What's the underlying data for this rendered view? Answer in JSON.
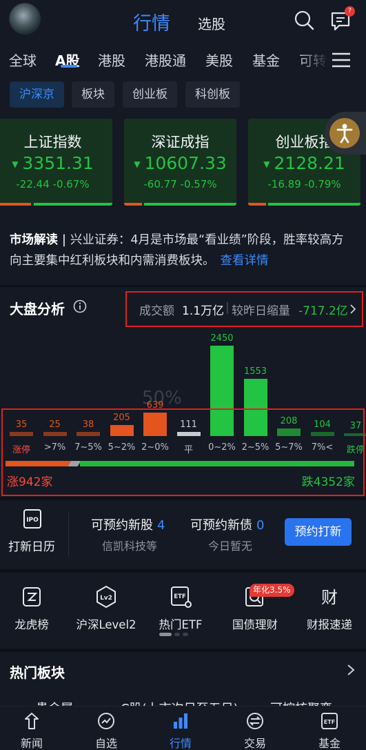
{
  "header": {
    "title": "行情",
    "subtitle": "选股",
    "msg_badge": "?"
  },
  "market_tabs": [
    "全球",
    "A股",
    "港股",
    "港股通",
    "美股",
    "基金",
    "可转"
  ],
  "sub_tabs": [
    "沪深京",
    "板块",
    "创业板",
    "科创板"
  ],
  "indices": [
    {
      "name": "上证指数",
      "value": "3351.31",
      "change": "-22.44",
      "pct": "-0.67%"
    },
    {
      "name": "深证成指",
      "value": "10607.33",
      "change": "-60.77",
      "pct": "-0.57%"
    },
    {
      "name": "创业板指",
      "value": "2128.21",
      "change": "-16.89",
      "pct": "-0.79%"
    }
  ],
  "news": {
    "tag": "市场解读",
    "text": "兴业证券：4月是市场最“看业绩”阶段，胜率较高方向主要集中红利板块和内需消费板块。",
    "link": "查看详情"
  },
  "market_analysis": {
    "title": "大盘分析",
    "turnover_label": "成交额",
    "turnover_value": "1.1万亿",
    "compare_label": "较昨日缩量",
    "compare_value": "-717.2亿",
    "watermark": "50%",
    "up_count": "涨942家",
    "down_count": "跌4352家",
    "colors": {
      "up": "#e4541f",
      "flat": "#c8ccd2",
      "down": "#23c343"
    }
  },
  "chart_data": {
    "type": "bar",
    "categories": [
      "涨停",
      ">7%",
      "7~5%",
      "5~2%",
      "2~0%",
      "平",
      "0~2%",
      "2~5%",
      "5~7%",
      "7%<",
      "跌停"
    ],
    "values": [
      35,
      25,
      38,
      205,
      639,
      111,
      2450,
      1553,
      208,
      104,
      37
    ],
    "value_labels": [
      "35",
      "25",
      "38",
      "205",
      "639",
      "111",
      "2450",
      "1553",
      "208",
      "104",
      "37"
    ]
  },
  "ipo": {
    "calendar_label": "打新日历",
    "stock_title": "可预约新股",
    "stock_count": "4",
    "stock_sub": "信凯科技等",
    "bond_title": "可预约新债",
    "bond_count": "0",
    "bond_sub": "今日暂无",
    "button": "预约打新"
  },
  "tools": [
    {
      "label": "龙虎榜",
      "icon": "dragon-tiger-icon"
    },
    {
      "label": "沪深Level2",
      "icon": "level2-icon"
    },
    {
      "label": "热门ETF",
      "icon": "etf-icon"
    },
    {
      "label": "国债理财",
      "icon": "bond-icon"
    },
    {
      "label": "财报速递",
      "icon": "finance-report-icon"
    }
  ],
  "tool_badge": "年化3.5%",
  "hot_sectors": {
    "title": "热门板块",
    "peek": [
      "贵金属",
      "C股(上市次日至五日)",
      "可控核聚变"
    ]
  },
  "bottom_nav": [
    "新闻",
    "自选",
    "行情",
    "交易",
    "基金"
  ]
}
